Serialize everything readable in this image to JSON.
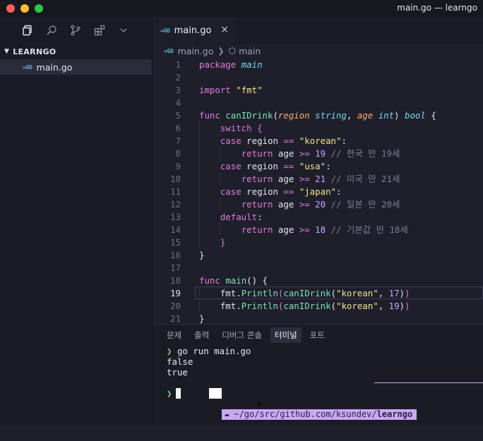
{
  "window": {
    "title": "main.go — learngo"
  },
  "traffic_lights": {
    "close_color": "#ff5f57",
    "minimize_color": "#febc2e",
    "maximize_color": "#28c840"
  },
  "activity_bar": {
    "icons": [
      "files-icon",
      "search-icon",
      "source-control-icon",
      "extensions-icon",
      "chevron-down-icon"
    ]
  },
  "explorer": {
    "folder": "LEARNGO",
    "files": [
      {
        "icon": "GO",
        "name": "main.go"
      }
    ]
  },
  "editor": {
    "tab": {
      "icon": "GO",
      "label": "main.go",
      "close": "×"
    },
    "breadcrumb": {
      "file_icon": "GO",
      "file": "main.go",
      "symbol": "main"
    },
    "current_line": 19,
    "lines": [
      {
        "n": "1"
      },
      {
        "n": "2"
      },
      {
        "n": "3"
      },
      {
        "n": "4"
      },
      {
        "n": "5"
      },
      {
        "n": "6"
      },
      {
        "n": "7"
      },
      {
        "n": "8"
      },
      {
        "n": "9"
      },
      {
        "n": "10"
      },
      {
        "n": "11"
      },
      {
        "n": "12"
      },
      {
        "n": "13"
      },
      {
        "n": "14"
      },
      {
        "n": "15"
      },
      {
        "n": "16"
      },
      {
        "n": "17"
      },
      {
        "n": "18"
      },
      {
        "n": "19"
      },
      {
        "n": "20"
      },
      {
        "n": "21"
      }
    ],
    "code": {
      "l1_kw": "package",
      "l1_pkg": "main",
      "l3_kw": "import",
      "l3_str": "\"fmt\"",
      "l5_kw": "func",
      "l5_fn": "canIDrink",
      "l5_p1": "region",
      "l5_t1": "string",
      "l5_p2": "age",
      "l5_t2": "int",
      "l5_ret": "bool",
      "l6_kw": "switch",
      "l7_kw": "case",
      "l7_str": "\"korean\"",
      "l8_kw": "return",
      "l8_num": "19",
      "l8_cmt": "// 한국 만 19세",
      "l9_kw": "case",
      "l9_str": "\"usa\"",
      "l10_kw": "return",
      "l10_num": "21",
      "l10_cmt": "// 미국 만 21세",
      "l11_kw": "case",
      "l11_str": "\"japan\"",
      "l12_kw": "return",
      "l12_num": "20",
      "l12_cmt": "// 일본 만 20세",
      "l13_kw": "default",
      "l14_kw": "return",
      "l14_num": "18",
      "l14_cmt": "// 기본값 만 18세",
      "l18_kw": "func",
      "l18_fn": "main",
      "l19_pkg": "fmt",
      "l19_fn": "Println",
      "l19_call": "canIDrink",
      "l19_str": "\"korean\"",
      "l19_num": "17",
      "l20_pkg": "fmt",
      "l20_fn": "Println",
      "l20_call": "canIDrink",
      "l20_str": "\"korean\"",
      "l20_num": "19"
    }
  },
  "panel": {
    "tabs": [
      "문제",
      "출력",
      "디버그 콘솔",
      "터미널",
      "포트"
    ],
    "active_tab": "터미널",
    "terminal": {
      "prompt_symbol": "❯",
      "command": "go run main.go",
      "output": [
        "false",
        "true"
      ],
      "path": "~/go/src/github.com/ksundev/",
      "path_bold": "learngo",
      "folder_glyph": "▬"
    }
  }
}
